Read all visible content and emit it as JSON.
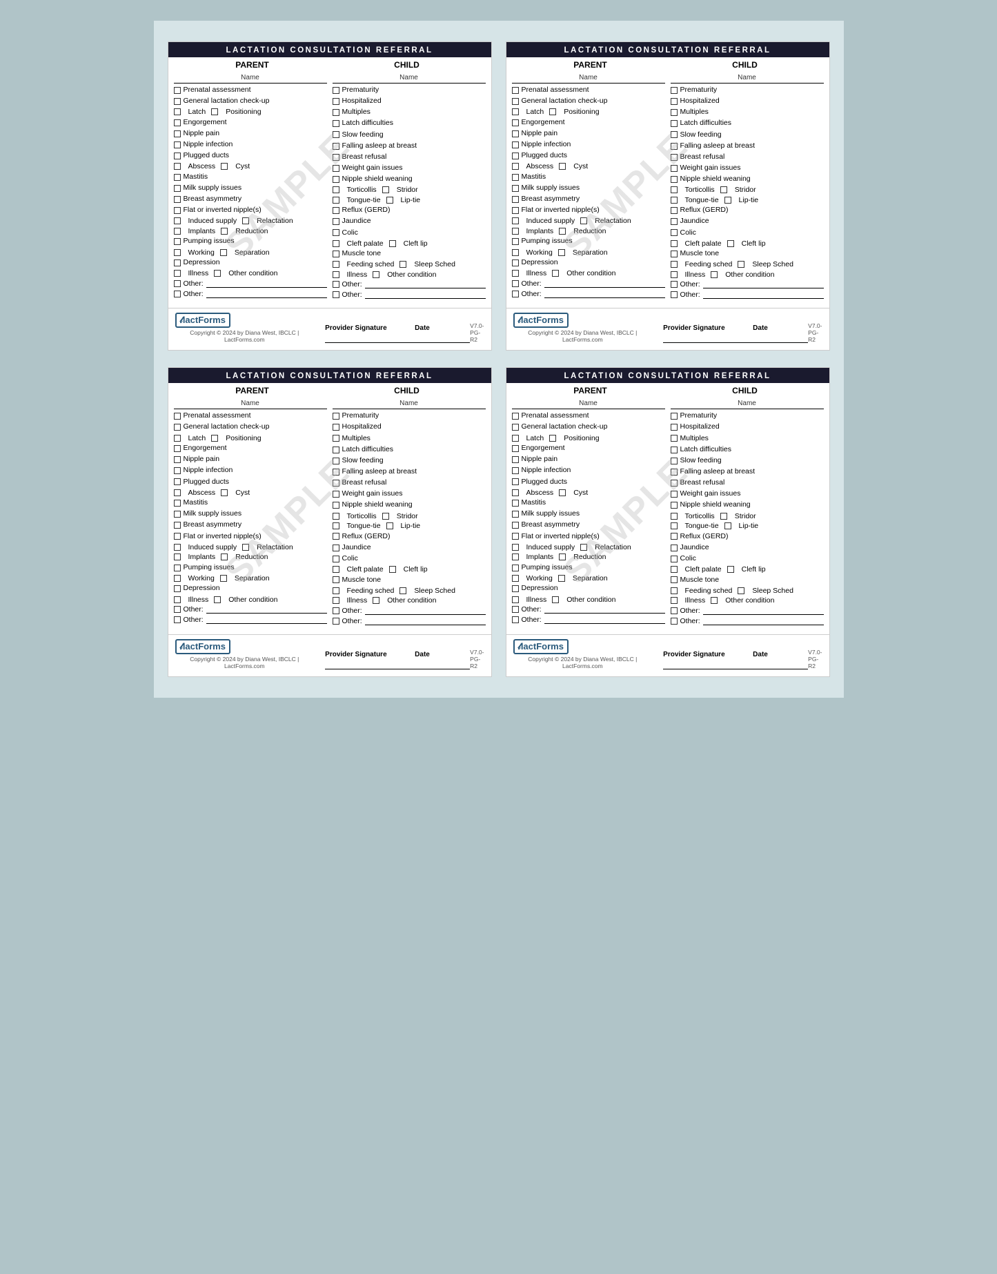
{
  "page": {
    "background": "#b0c4c8"
  },
  "form": {
    "title": "LACTATION CONSULTATION REFERRAL",
    "col1_header": "PARENT",
    "col2_header": "CHILD",
    "name_label": "Name",
    "watermark": "SAMPLE",
    "parent_items": [
      "Prenatal assessment",
      "General lactation check-up",
      "Latch    □ Positioning",
      "Engorgement",
      "Nipple pain",
      "Nipple infection",
      "Plugged ducts",
      "Abscess  □ Cyst",
      "Mastitis",
      "Milk supply issues",
      "Breast asymmetry",
      "Flat or inverted nipple(s)",
      "Induced supply  □ Relactation",
      "Implants  □ Reduction",
      "Pumping issues",
      "Working  □ Separation",
      "Depression",
      "Illness    □ Other condition"
    ],
    "child_items": [
      "Prematurity",
      "Hospitalized",
      "Multiples",
      "Latch difficulties",
      "Slow feeding",
      "Falling asleep at breast",
      "Breast refusal",
      "Weight gain issues",
      "Nipple shield weaning",
      "Torticollis    □ Stridor",
      "Tongue-tie    □ Lip-tie",
      "Reflux (GERD)",
      "Jaundice",
      "Colic",
      "Cleft palate    □ Cleft lip",
      "Muscle tone",
      "Feeding sched  □ Sleep Sched",
      "Illness    □ Other condition"
    ],
    "other_label": "Other:",
    "provider_sig_label": "Provider Signature",
    "date_label": "Date",
    "copyright": "Copyright © 2024 by Diana West, IBCLC | LactForms.com",
    "version": "V7.0-PG-R2",
    "logo": "lactForms"
  }
}
